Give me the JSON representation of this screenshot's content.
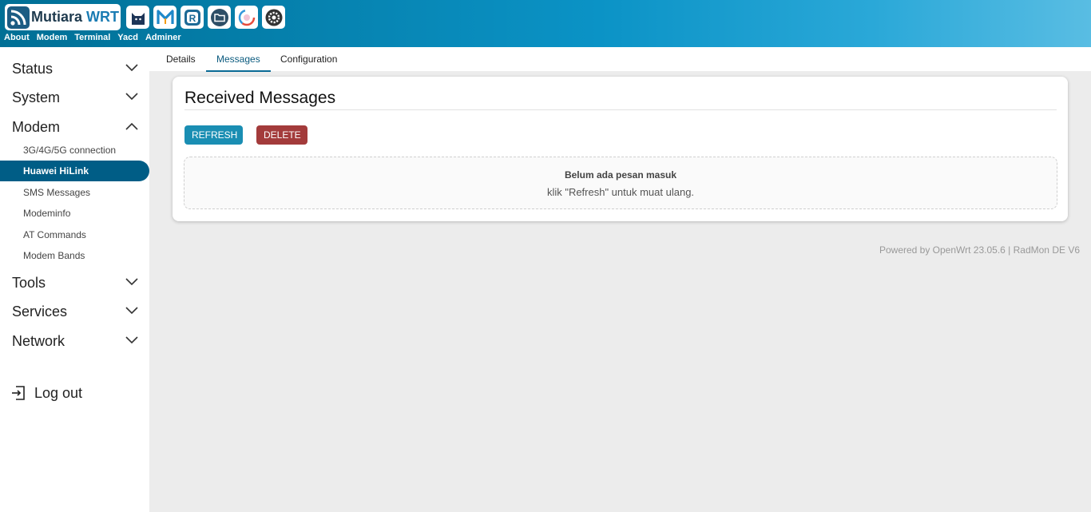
{
  "header": {
    "brand_name": "Mutiara",
    "brand_accent": "WRT",
    "app_icons": [
      "cat-icon",
      "m-logo-icon",
      "r-logo-icon",
      "folder-icon",
      "gauge-icon",
      "gear-icon"
    ],
    "topnav": [
      "About",
      "Modem",
      "Terminal",
      "Yacd",
      "Adminer"
    ]
  },
  "sidebar": {
    "sections": [
      {
        "label": "Status",
        "expanded": false
      },
      {
        "label": "System",
        "expanded": false
      },
      {
        "label": "Modem",
        "expanded": true
      },
      {
        "label": "Tools",
        "expanded": false
      },
      {
        "label": "Services",
        "expanded": false
      },
      {
        "label": "Network",
        "expanded": false
      }
    ],
    "modem_items": [
      {
        "label": "3G/4G/5G connection",
        "active": false
      },
      {
        "label": "Huawei HiLink",
        "active": true
      },
      {
        "label": "SMS Messages",
        "active": false
      },
      {
        "label": "Modeminfo",
        "active": false
      },
      {
        "label": "AT Commands",
        "active": false
      },
      {
        "label": "Modem Bands",
        "active": false
      }
    ],
    "logout_label": "Log out"
  },
  "tabs": [
    {
      "label": "Details",
      "active": false
    },
    {
      "label": "Messages",
      "active": true
    },
    {
      "label": "Configuration",
      "active": false
    }
  ],
  "card": {
    "title": "Received Messages",
    "refresh_label": "REFRESH",
    "delete_label": "DELETE",
    "empty_title": "Belum ada pesan masuk",
    "empty_subtitle": "klik \"Refresh\" untuk muat ulang."
  },
  "footer": "Powered by OpenWrt 23.05.6 | RadMon DE V6",
  "colors": {
    "header_start": "#006f95",
    "header_end": "#59bde3",
    "active_item": "#005d86",
    "refresh_button": "#1a8eb3",
    "delete_button": "#a33b3b"
  }
}
